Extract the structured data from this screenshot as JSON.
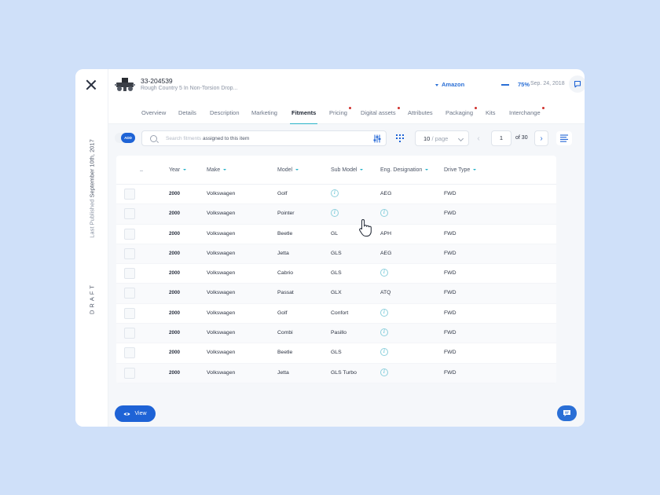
{
  "sidebar": {
    "last_published_label": "Last Published",
    "last_published_date": "September 10th, 2017",
    "status": "DRAFT"
  },
  "product": {
    "sku": "33-204539",
    "name": "Rough Country 5 In Non-Torsion Drop..."
  },
  "channel": {
    "name": "Amazon",
    "completion": "75%",
    "date": "Sep. 24, 2018"
  },
  "user": {
    "initials": "MA"
  },
  "tabs": [
    {
      "label": "Overview",
      "active": false,
      "alert": false
    },
    {
      "label": "Details",
      "active": false,
      "alert": false
    },
    {
      "label": "Description",
      "active": false,
      "alert": false
    },
    {
      "label": "Marketing",
      "active": false,
      "alert": false
    },
    {
      "label": "Fitments",
      "active": true,
      "alert": false
    },
    {
      "label": "Pricing",
      "active": false,
      "alert": true
    },
    {
      "label": "Digital assets",
      "active": false,
      "alert": true
    },
    {
      "label": "Attributes",
      "active": false,
      "alert": false
    },
    {
      "label": "Packaging",
      "active": false,
      "alert": true
    },
    {
      "label": "Kits",
      "active": false,
      "alert": false
    },
    {
      "label": "Interchange",
      "active": false,
      "alert": true
    }
  ],
  "toolbar": {
    "toggle_label": "ADD",
    "search_placeholder": "Search fitments",
    "search_suffix": "assigned to this item",
    "per_page_value": "10",
    "per_page_unit": "/ page",
    "page_current": "1",
    "page_of": "of",
    "page_total": "30"
  },
  "table": {
    "columns": [
      "Year",
      "Make",
      "Model",
      "Sub Model",
      "Eng. Designation",
      "Drive Type"
    ],
    "rows": [
      {
        "year": "2000",
        "make": "Volkswagen",
        "model": "Golf",
        "sub_model": "",
        "eng": "AEG",
        "drive": "FWD"
      },
      {
        "year": "2000",
        "make": "Volkswagen",
        "model": "Pointer",
        "sub_model": "",
        "eng": "",
        "drive": "FWD"
      },
      {
        "year": "2000",
        "make": "Volkswagen",
        "model": "Beetle",
        "sub_model": "GL",
        "eng": "APH",
        "drive": "FWD"
      },
      {
        "year": "2000",
        "make": "Volkswagen",
        "model": "Jetta",
        "sub_model": "GLS",
        "eng": "AEG",
        "drive": "FWD"
      },
      {
        "year": "2000",
        "make": "Volkswagen",
        "model": "Cabrio",
        "sub_model": "GLS",
        "eng": "",
        "drive": "FWD"
      },
      {
        "year": "2000",
        "make": "Volkswagen",
        "model": "Passat",
        "sub_model": "GLX",
        "eng": "ATQ",
        "drive": "FWD"
      },
      {
        "year": "2000",
        "make": "Volkswagen",
        "model": "Golf",
        "sub_model": "Confort",
        "eng": "",
        "drive": "FWD"
      },
      {
        "year": "2000",
        "make": "Volkswagen",
        "model": "Combi",
        "sub_model": "Pasillo",
        "eng": "",
        "drive": "FWD"
      },
      {
        "year": "2000",
        "make": "Volkswagen",
        "model": "Beetle",
        "sub_model": "GLS",
        "eng": "",
        "drive": "FWD"
      },
      {
        "year": "2000",
        "make": "Volkswagen",
        "model": "Jetta",
        "sub_model": "GLS Turbo",
        "eng": "",
        "drive": "FWD"
      }
    ]
  },
  "footer": {
    "view_label": "View"
  },
  "colors": {
    "accent": "#1e63d6",
    "teal": "#2ab3c9",
    "alert": "#d0312d",
    "background": "#cfe0f9"
  }
}
